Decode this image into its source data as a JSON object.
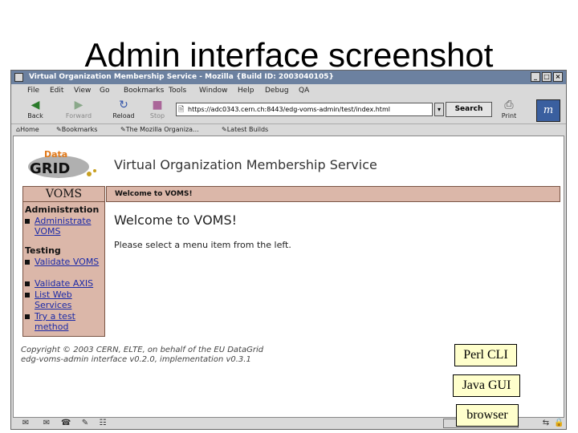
{
  "slide": {
    "title": "Admin interface screenshot"
  },
  "window": {
    "title": "Virtual Organization Membership Service - Mozilla {Build ID: 2003040105}",
    "controls": [
      "_",
      "□",
      "×"
    ]
  },
  "menu": [
    "File",
    "Edit",
    "View",
    "Go",
    "Bookmarks",
    "Tools",
    "Window",
    "Help",
    "Debug",
    "QA"
  ],
  "nav": {
    "back": "Back",
    "forward": "Forward",
    "reload": "Reload",
    "stop": "Stop",
    "url": "https://adc0343.cern.ch:8443/edg-voms-admin/test/index.html",
    "search": "Search",
    "print": "Print"
  },
  "bookmarks": [
    "Home",
    "Bookmarks",
    "The Mozilla Organiza...",
    "Latest Builds"
  ],
  "page": {
    "logo_top": "Data",
    "logo_main": "GRID",
    "banner_title": "Virtual Organization Membership Service",
    "sidebar_header": "VOMS",
    "welcome_bar": "Welcome to VOMS!",
    "heading": "Welcome to VOMS!",
    "instruction": "Please select a menu item from the left.",
    "sidebar": {
      "admin_section": "Administration",
      "admin_items": [
        "Administrate VOMS"
      ],
      "testing_section": "Testing",
      "testing_items": [
        "Validate VOMS",
        "Validate AXIS",
        "List Web Services",
        "Try a test method"
      ]
    },
    "copyright_line1": "Copyright © 2003 CERN, ELTE, on behalf of the EU DataGrid",
    "copyright_line2": "edg-voms-admin interface v0.2.0, implementation v0.3.1"
  },
  "overlays": {
    "perl": "Perl CLI",
    "java": "Java GUI",
    "browser": "browser"
  }
}
